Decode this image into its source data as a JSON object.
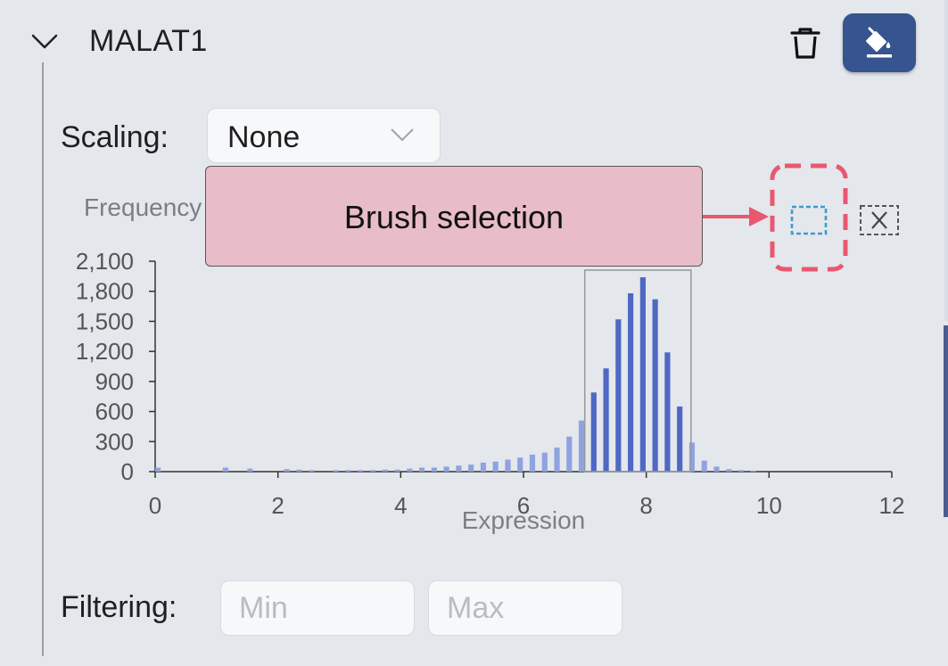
{
  "gene": {
    "title": "MALAT1"
  },
  "scaling": {
    "label": "Scaling:",
    "value": "None"
  },
  "callout": {
    "text": "Brush selection"
  },
  "filtering": {
    "label": "Filtering:",
    "min_placeholder": "Min",
    "max_placeholder": "Max"
  },
  "colors": {
    "accent": "#36558f",
    "bar": "#8fa3e0",
    "bar_selected": "#4f68c4",
    "callout": "#e8bdc8",
    "highlight": "#e8586f"
  },
  "chart_data": {
    "type": "bar",
    "ylabel": "Frequency",
    "xlabel": "Expression",
    "xlim": [
      0,
      12
    ],
    "ylim": [
      0,
      2100
    ],
    "xticks": [
      "0",
      "2",
      "4",
      "6",
      "8",
      "10",
      "12"
    ],
    "yticks": [
      "0",
      "300",
      "600",
      "900",
      "1,200",
      "1,500",
      "1,800",
      "2,100"
    ],
    "bin_width": 0.2,
    "selection": [
      7.1,
      8.7
    ],
    "bins": [
      {
        "x": 0.0,
        "y": 40
      },
      {
        "x": 1.1,
        "y": 40
      },
      {
        "x": 1.5,
        "y": 30
      },
      {
        "x": 2.1,
        "y": 25
      },
      {
        "x": 2.3,
        "y": 20
      },
      {
        "x": 2.5,
        "y": 15
      },
      {
        "x": 2.9,
        "y": 15
      },
      {
        "x": 3.1,
        "y": 15
      },
      {
        "x": 3.3,
        "y": 15
      },
      {
        "x": 3.5,
        "y": 15
      },
      {
        "x": 3.7,
        "y": 20
      },
      {
        "x": 3.9,
        "y": 20
      },
      {
        "x": 4.1,
        "y": 30
      },
      {
        "x": 4.3,
        "y": 40
      },
      {
        "x": 4.5,
        "y": 40
      },
      {
        "x": 4.7,
        "y": 50
      },
      {
        "x": 4.9,
        "y": 60
      },
      {
        "x": 5.1,
        "y": 70
      },
      {
        "x": 5.3,
        "y": 90
      },
      {
        "x": 5.5,
        "y": 100
      },
      {
        "x": 5.7,
        "y": 120
      },
      {
        "x": 5.9,
        "y": 140
      },
      {
        "x": 6.1,
        "y": 170
      },
      {
        "x": 6.3,
        "y": 190
      },
      {
        "x": 6.5,
        "y": 240
      },
      {
        "x": 6.7,
        "y": 350
      },
      {
        "x": 6.9,
        "y": 510
      },
      {
        "x": 7.1,
        "y": 790
      },
      {
        "x": 7.3,
        "y": 1030
      },
      {
        "x": 7.5,
        "y": 1520
      },
      {
        "x": 7.7,
        "y": 1780
      },
      {
        "x": 7.9,
        "y": 1940
      },
      {
        "x": 8.1,
        "y": 1720
      },
      {
        "x": 8.3,
        "y": 1190
      },
      {
        "x": 8.5,
        "y": 650
      },
      {
        "x": 8.7,
        "y": 290
      },
      {
        "x": 8.9,
        "y": 110
      },
      {
        "x": 9.1,
        "y": 50
      },
      {
        "x": 9.3,
        "y": 25
      },
      {
        "x": 9.5,
        "y": 15
      },
      {
        "x": 9.7,
        "y": 10
      }
    ]
  }
}
